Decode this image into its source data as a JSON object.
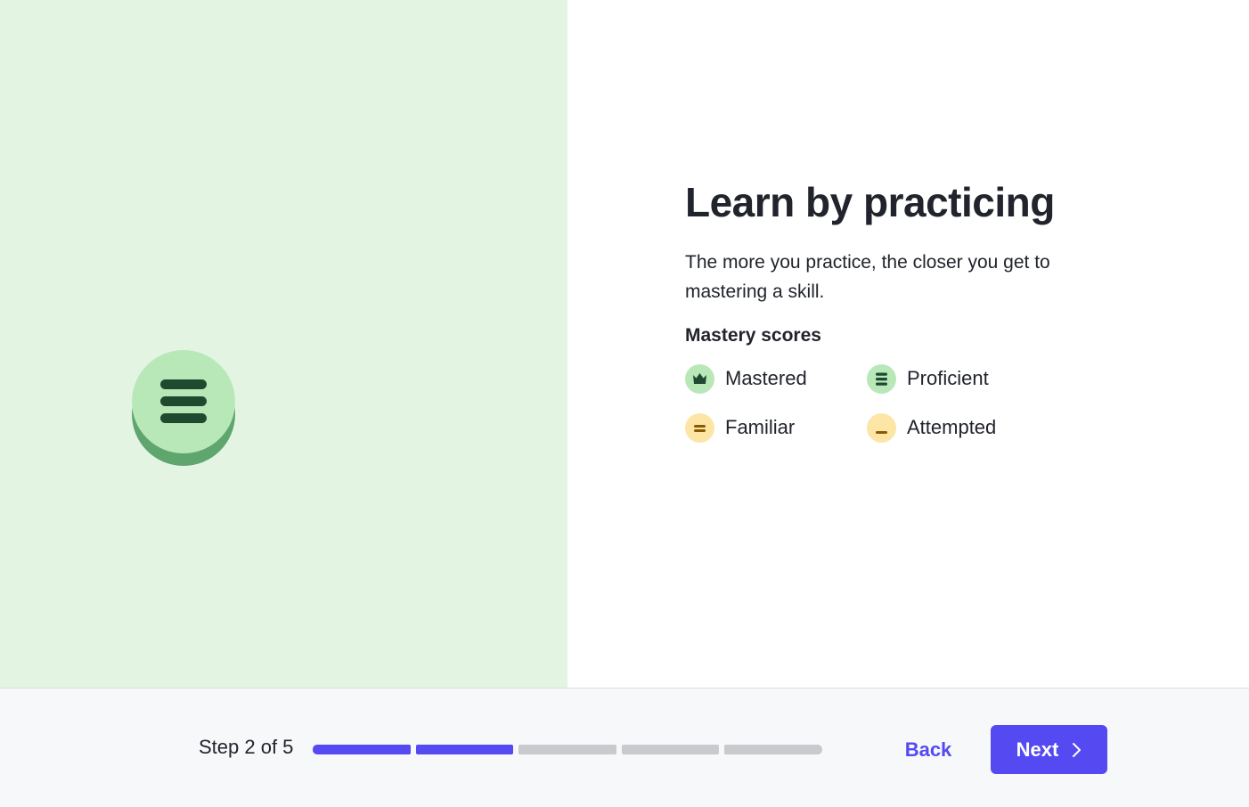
{
  "illustration": {
    "icon": "proficient-badge-icon"
  },
  "content": {
    "title": "Learn by practicing",
    "description": "The more you practice, the closer you get to mastering a skill.",
    "mastery_heading": "Mastery scores",
    "legend": [
      {
        "label": "Mastered",
        "icon": "crown-icon",
        "color": "#b9e8b8"
      },
      {
        "label": "Proficient",
        "icon": "three-bars-icon",
        "color": "#b9e8b8"
      },
      {
        "label": "Familiar",
        "icon": "two-bars-icon",
        "color": "#fce5a5"
      },
      {
        "label": "Attempted",
        "icon": "one-bar-icon",
        "color": "#fce5a5"
      }
    ]
  },
  "footer": {
    "step_text": "Step 2 of 5",
    "progress": {
      "current": 2,
      "total": 5
    },
    "back_label": "Back",
    "next_label": "Next"
  },
  "colors": {
    "accent": "#5549f2",
    "left_panel_bg": "#e3f5e2",
    "mastered_green": "#b9e8b8",
    "dark_green": "#1f4a30",
    "familiar_yellow": "#fce5a5"
  }
}
